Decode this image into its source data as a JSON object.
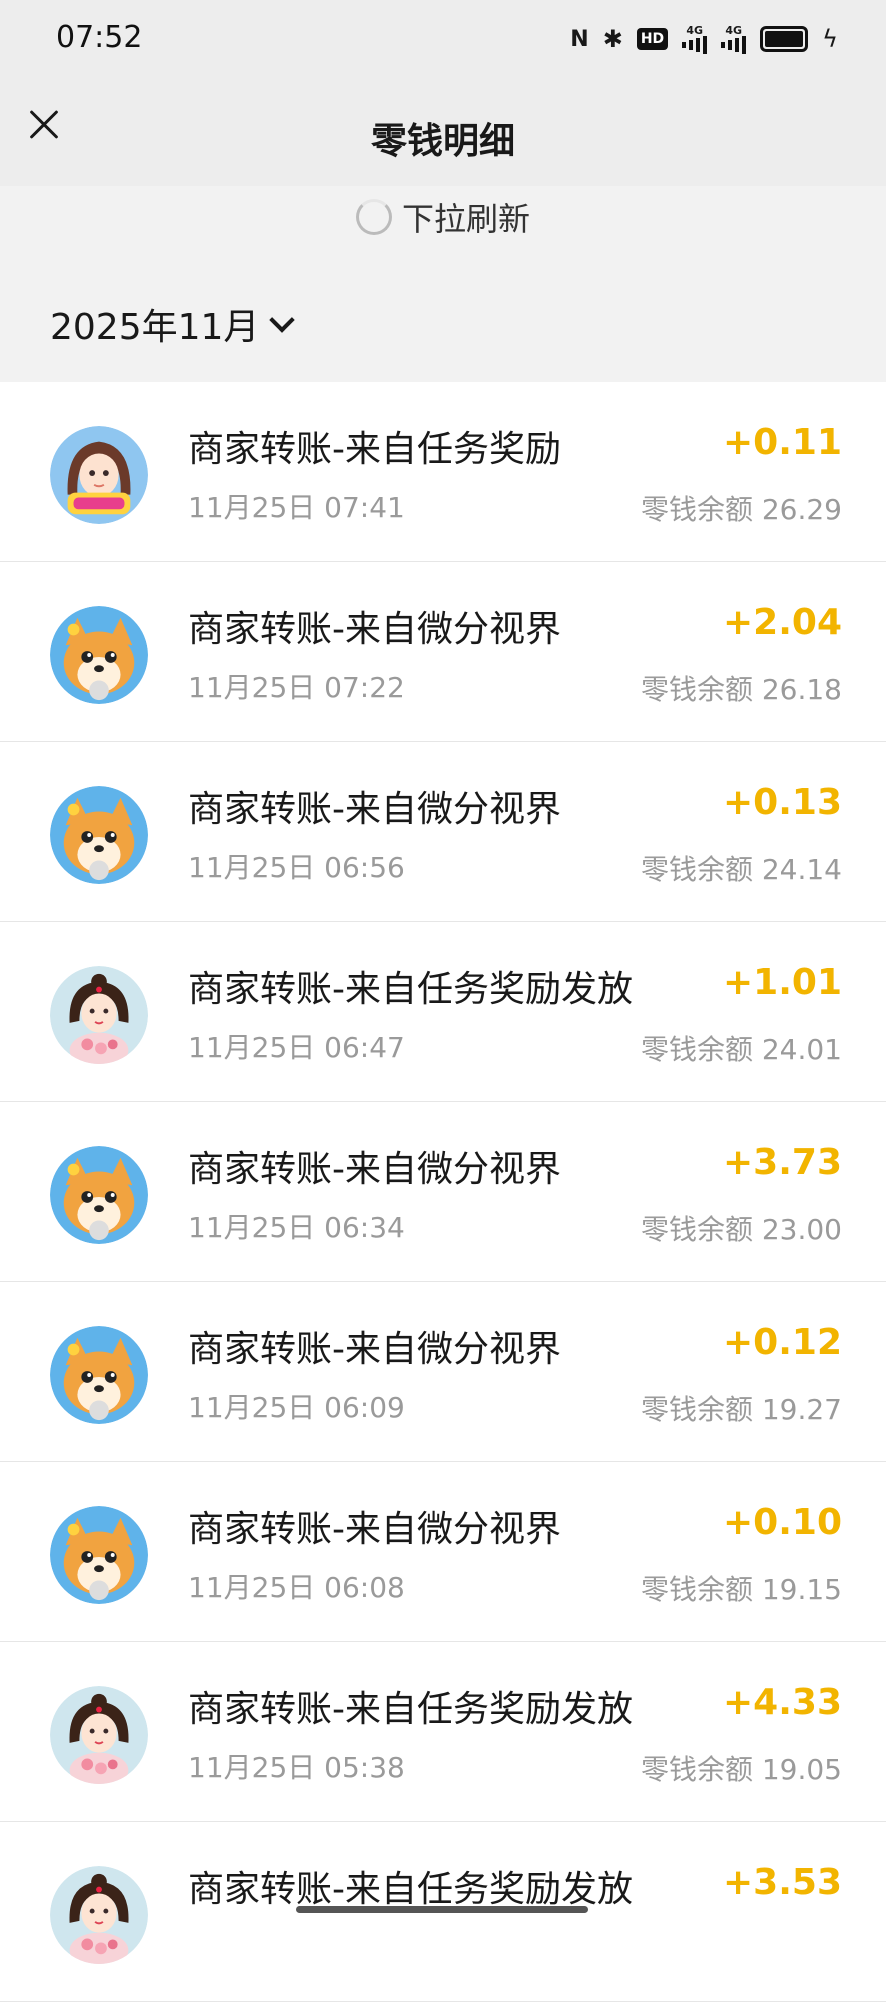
{
  "status": {
    "time": "07:52",
    "hd": "HD",
    "net1": "4G",
    "net2": "4G"
  },
  "nav": {
    "title": "零钱明细"
  },
  "refresh": {
    "text": "下拉刷新"
  },
  "month": {
    "label": "2025年11月"
  },
  "colors": {
    "amount": "#f2b400",
    "header_bg": "#ededed",
    "sub_text": "#9a9a9a"
  },
  "transactions": [
    {
      "title": "商家转账-来自任务奖励",
      "time": "11月25日 07:41",
      "amount": "+0.11",
      "balance": "零钱余额 26.29",
      "avatar": "girl-avatar"
    },
    {
      "title": "商家转账-来自微分视界",
      "time": "11月25日 07:22",
      "amount": "+2.04",
      "balance": "零钱余额 26.18",
      "avatar": "dog-avatar"
    },
    {
      "title": "商家转账-来自微分视界",
      "time": "11月25日 06:56",
      "amount": "+0.13",
      "balance": "零钱余额 24.14",
      "avatar": "dog-avatar"
    },
    {
      "title": "商家转账-来自任务奖励发放",
      "time": "11月25日 06:47",
      "amount": "+1.01",
      "balance": "零钱余额 24.01",
      "avatar": "princess-avatar"
    },
    {
      "title": "商家转账-来自微分视界",
      "time": "11月25日 06:34",
      "amount": "+3.73",
      "balance": "零钱余额 23.00",
      "avatar": "dog-avatar"
    },
    {
      "title": "商家转账-来自微分视界",
      "time": "11月25日 06:09",
      "amount": "+0.12",
      "balance": "零钱余额 19.27",
      "avatar": "dog-avatar"
    },
    {
      "title": "商家转账-来自微分视界",
      "time": "11月25日 06:08",
      "amount": "+0.10",
      "balance": "零钱余额 19.15",
      "avatar": "dog-avatar"
    },
    {
      "title": "商家转账-来自任务奖励发放",
      "time": "11月25日 05:38",
      "amount": "+4.33",
      "balance": "零钱余额 19.05",
      "avatar": "princess-avatar"
    },
    {
      "title": "商家转账-来自任务奖励发放",
      "time": "",
      "amount": "+3.53",
      "balance": "",
      "avatar": "princess-avatar"
    }
  ]
}
